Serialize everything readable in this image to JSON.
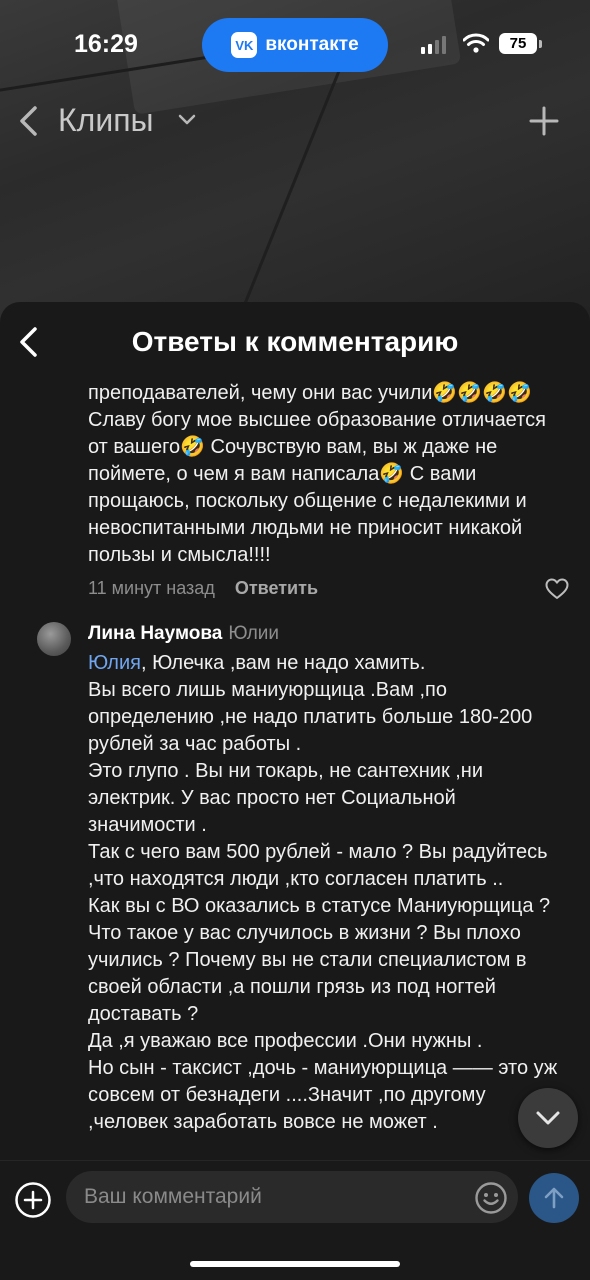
{
  "status_bar": {
    "time": "16:29",
    "app_pill": "вконтакте",
    "vk_logo": "VK",
    "battery": "75"
  },
  "clips_header": {
    "title": "Клипы"
  },
  "sheet": {
    "title": "Ответы к комментарию"
  },
  "comment1": {
    "text": "преподавателей, чему они вас учили🤣🤣🤣🤣 Славу богу мое высшее образование отличается от вашего🤣 Сочувствую вам, вы ж даже не поймете, о чем я вам написала🤣 С вами прощаюсь, поскольку общение с недалекими и невоспитанными людьми не приносит никакой пользы и смысла!!!!",
    "time": "11 минут назад",
    "reply_label": "Ответить"
  },
  "comment2": {
    "author": "Лина Наумова",
    "reply_to": "Юлии",
    "mention": "Юлия",
    "text": ", Юлечка ,вам не надо хамить.\nВы всего лишь маниуюрщица .Вам ,по определению ,не надо платить больше 180-200 рублей за час работы .\nЭто глупо . Вы ни токарь, не сантехник ,ни электрик.  У вас просто нет Социальной значимости .\nТак с чего вам 500 рублей - мало ? Вы радуйтесь ,что находятся люди ,кто согласен платить ..\nКак вы с ВО оказались в статусе Маниуюрщица ? Что такое у вас случилось в жизни ? Вы плохо учились ? Почему вы не стали специалистом в своей области ,а пошли грязь из под ногтей доставать ?\nДа ,я уважаю все профессии .Они нужны .\nНо сын - таксист ,дочь - маниуюрщица —— это уж совсем от безнадеги ....Значит ,по другому ,человек заработать вовсе не может ."
  },
  "composer": {
    "placeholder": "Ваш комментарий"
  },
  "icons": {
    "back": "chevron-left-icon",
    "dropdown": "chevron-down-icon",
    "plus": "plus-icon",
    "heart": "heart-icon",
    "scroll_down": "chevron-down-icon",
    "add": "plus-circle-icon",
    "emoji": "smiley-icon",
    "send": "arrow-up-icon"
  },
  "colors": {
    "vk_blue": "#1d7af2",
    "sheet_bg": "#191919",
    "mention": "#70a6f0",
    "send_button": "#2a5787"
  }
}
